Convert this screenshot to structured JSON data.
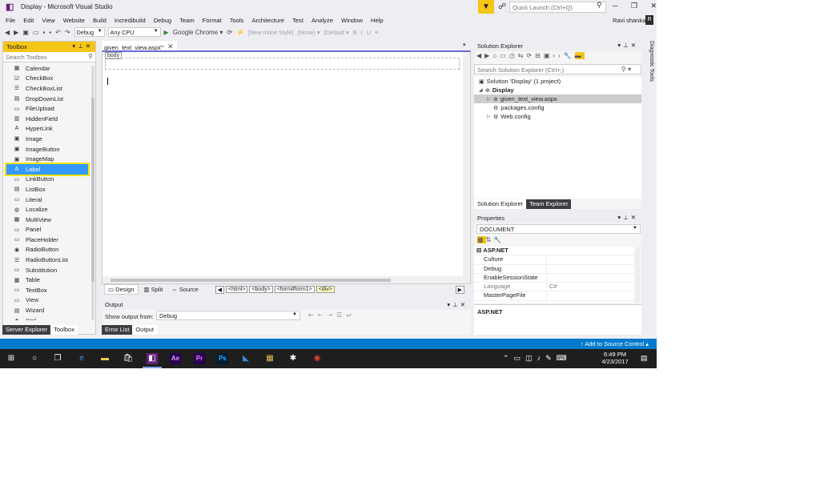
{
  "window": {
    "title": "Display - Microsoft Visual Studio",
    "quick_launch_placeholder": "Quick Launch (Ctrl+Q)",
    "user": "Ravi shankar",
    "user_initial": "R"
  },
  "menu": [
    "File",
    "Edit",
    "View",
    "Website",
    "Build",
    "Incredibuild",
    "Debug",
    "Team",
    "Format",
    "Tools",
    "Architecture",
    "Test",
    "Analyze",
    "Window",
    "Help"
  ],
  "toolbar": {
    "config": "Debug",
    "platform": "Any CPU",
    "browser": "Google Chrome",
    "new_inline_style": "New Inline Style",
    "none_option": "(None)",
    "default_option": "(Default"
  },
  "toolbox": {
    "title": "Toolbox",
    "search_placeholder": "Search Toolbox",
    "items": [
      {
        "label": "Calendar",
        "icon": "calendar-icon",
        "glyph": "▦"
      },
      {
        "label": "CheckBox",
        "icon": "checkbox-icon",
        "glyph": "☑"
      },
      {
        "label": "CheckBoxList",
        "icon": "checkboxlist-icon",
        "glyph": "☰"
      },
      {
        "label": "DropDownList",
        "icon": "dropdownlist-icon",
        "glyph": "▤"
      },
      {
        "label": "FileUpload",
        "icon": "fileupload-icon",
        "glyph": "▭"
      },
      {
        "label": "HiddenField",
        "icon": "hiddenfield-icon",
        "glyph": "▥"
      },
      {
        "label": "HyperLink",
        "icon": "hyperlink-icon",
        "glyph": "A"
      },
      {
        "label": "Image",
        "icon": "image-icon",
        "glyph": "▣"
      },
      {
        "label": "ImageButton",
        "icon": "imagebutton-icon",
        "glyph": "▣"
      },
      {
        "label": "ImageMap",
        "icon": "imagemap-icon",
        "glyph": "▣"
      },
      {
        "label": "Label",
        "icon": "label-icon",
        "glyph": "A",
        "selected": true
      },
      {
        "label": "LinkButton",
        "icon": "linkbutton-icon",
        "glyph": "▭"
      },
      {
        "label": "ListBox",
        "icon": "listbox-icon",
        "glyph": "▤"
      },
      {
        "label": "Literal",
        "icon": "literal-icon",
        "glyph": "▭"
      },
      {
        "label": "Localize",
        "icon": "localize-icon",
        "glyph": "◍"
      },
      {
        "label": "MultiView",
        "icon": "multiview-icon",
        "glyph": "▦"
      },
      {
        "label": "Panel",
        "icon": "panel-icon",
        "glyph": "▭"
      },
      {
        "label": "PlaceHolder",
        "icon": "placeholder-icon",
        "glyph": "▭"
      },
      {
        "label": "RadioButton",
        "icon": "radiobutton-icon",
        "glyph": "◉"
      },
      {
        "label": "RadioButtonList",
        "icon": "radiobuttonlist-icon",
        "glyph": "☰"
      },
      {
        "label": "Substitution",
        "icon": "substitution-icon",
        "glyph": "▭"
      },
      {
        "label": "Table",
        "icon": "table-icon",
        "glyph": "▦"
      },
      {
        "label": "TextBox",
        "icon": "textbox-icon",
        "glyph": "▭"
      },
      {
        "label": "View",
        "icon": "view-icon",
        "glyph": "▭"
      },
      {
        "label": "Wizard",
        "icon": "wizard-icon",
        "glyph": "▤"
      },
      {
        "label": "Xml",
        "icon": "xml-icon",
        "glyph": "◈"
      }
    ],
    "tabs": [
      "Server Explorer",
      "Toolbox"
    ]
  },
  "editor": {
    "tab": "given_text_view.aspx",
    "body_tag": "body",
    "views": [
      "Design",
      "Split",
      "Source"
    ],
    "breadcrumbs": [
      "<html>",
      "<body>",
      "<form#form1>",
      "<div>"
    ]
  },
  "output": {
    "title": "Output",
    "show_label": "Show output from:",
    "source": "Debug",
    "tabs": [
      "Error List",
      "Output"
    ]
  },
  "solution_explorer": {
    "title": "Solution Explorer",
    "search_placeholder": "Search Solution Explorer (Ctrl+;)",
    "tree": [
      "Solution 'Display' (1 project)",
      "Display",
      "given_text_view.aspx",
      "packages.config",
      "Web.config"
    ],
    "tabs": [
      "Solution Explorer",
      "Team Explorer"
    ]
  },
  "properties": {
    "title": "Properties",
    "object": "DOCUMENT",
    "category": "ASP.NET",
    "rows": [
      {
        "name": "Culture",
        "value": ""
      },
      {
        "name": "Debug",
        "value": ""
      },
      {
        "name": "EnableSessionState",
        "value": ""
      },
      {
        "name": "Language",
        "value": "C#"
      },
      {
        "name": "MasterPageFile",
        "value": ""
      }
    ],
    "description": "ASP.NET"
  },
  "diagnostic_tools": "Diagnostic Tools",
  "statusbar": {
    "source_control": "Add to Source Control"
  },
  "taskbar": {
    "time": "6:49 PM",
    "date": "4/23/2017"
  },
  "colors": {
    "accent": "#007acc",
    "highlight": "#f5c518",
    "selection": "#3399ff",
    "vs_purple": "#68217a"
  }
}
